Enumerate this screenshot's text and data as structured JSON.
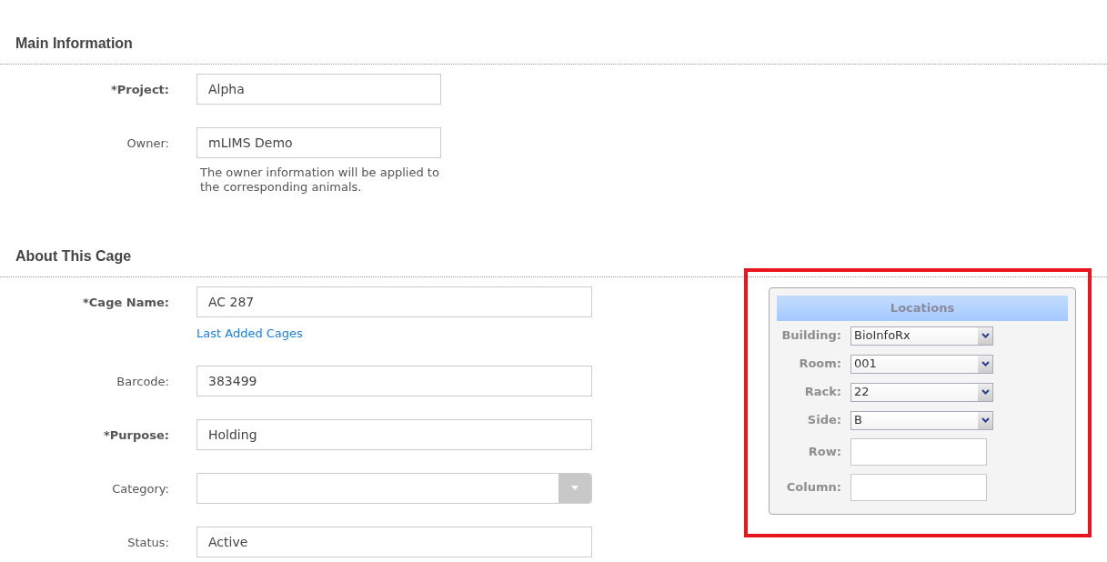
{
  "main_information": {
    "title": "Main Information",
    "fields": [
      {
        "label": "*Project:",
        "required": true,
        "kind": "text",
        "value": "Alpha"
      },
      {
        "label": "Owner:",
        "required": false,
        "kind": "text",
        "value": "mLIMS Demo",
        "help": "The owner information will be applied to the corresponding animals."
      }
    ]
  },
  "about_this_cage": {
    "title": "About This Cage",
    "fields": [
      {
        "label": "*Cage Name:",
        "required": true,
        "kind": "text",
        "value": "AC 287",
        "link": "Last Added Cages"
      },
      {
        "label": "Barcode:",
        "required": false,
        "kind": "text",
        "value": "383499"
      },
      {
        "label": "*Purpose:",
        "required": true,
        "kind": "text",
        "value": "Holding"
      },
      {
        "label": "Category:",
        "required": false,
        "kind": "select"
      },
      {
        "label": "Status:",
        "required": false,
        "kind": "text",
        "value": "Active"
      }
    ]
  },
  "locations": {
    "title": "Locations",
    "fields": [
      {
        "label": "Building:",
        "kind": "select",
        "value": "BioInfoRx"
      },
      {
        "label": "Room:",
        "kind": "select",
        "value": "001"
      },
      {
        "label": "Rack:",
        "kind": "select",
        "value": "22"
      },
      {
        "label": "Side:",
        "kind": "select",
        "value": "B"
      },
      {
        "label": "Row:",
        "kind": "text"
      },
      {
        "label": "Column:",
        "kind": "text"
      }
    ]
  }
}
